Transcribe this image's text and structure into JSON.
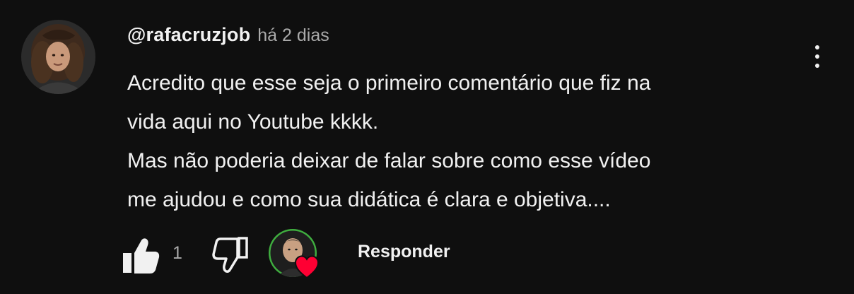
{
  "comment": {
    "username": "@rafacruzjob",
    "timestamp": "há 2 dias",
    "text_lines": [
      "Acredito que esse seja o primeiro comentário que fiz na",
      "vida aqui no Youtube kkkk.",
      "Mas não poderia deixar de falar sobre como esse vídeo",
      "me ajudou e como sua didática é clara e objetiva...."
    ],
    "avatar_icon": "user-avatar-photo"
  },
  "actions": {
    "like_icon": "thumbs-up-icon",
    "like_count": "1",
    "dislike_icon": "thumbs-down-icon",
    "creator_heart_icon": "creator-heart-icon",
    "reply_label": "Responder"
  },
  "menu": {
    "icon": "more-vertical-icon"
  },
  "colors": {
    "background": "#0f0f0f",
    "text_primary": "#f1f1f1",
    "text_secondary": "#aaaaaa",
    "heart_red": "#ff0033"
  }
}
